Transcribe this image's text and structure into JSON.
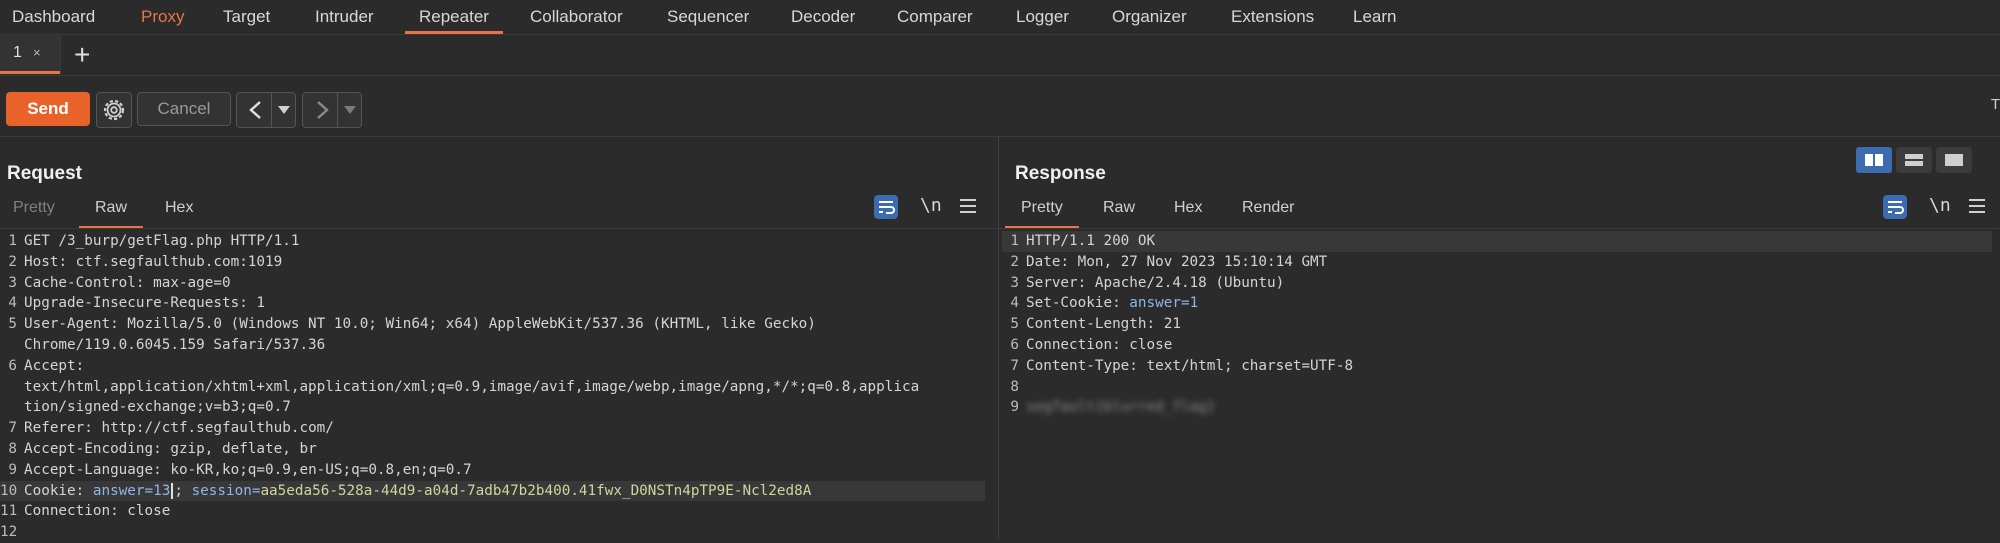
{
  "nav": {
    "tabs": [
      "Dashboard",
      "Proxy",
      "Target",
      "Intruder",
      "Repeater",
      "Collaborator",
      "Sequencer",
      "Decoder",
      "Comparer",
      "Logger",
      "Organizer",
      "Extensions",
      "Learn"
    ],
    "active": "Repeater"
  },
  "repeater_tabs": {
    "tab1": {
      "label": "1",
      "close": "×"
    },
    "add": "+"
  },
  "toolbar": {
    "send": "Send",
    "cancel": "Cancel",
    "right_text": "T"
  },
  "request": {
    "title": "Request",
    "tabs": [
      "Pretty",
      "Raw",
      "Hex"
    ],
    "active_tab": "Raw",
    "newline_toggle": "\\n",
    "lines": [
      {
        "n": "1",
        "t": "GET /3_burp/getFlag.php HTTP/1.1"
      },
      {
        "n": "2",
        "h": "Host",
        "v": "ctf.segfaulthub.com:1019"
      },
      {
        "n": "3",
        "h": "Cache-Control",
        "v": "max-age=0"
      },
      {
        "n": "4",
        "h": "Upgrade-Insecure-Requests",
        "v": "1"
      },
      {
        "n": "5",
        "h": "User-Agent",
        "v": "Mozilla/5.0 (Windows NT 10.0; Win64; x64) AppleWebKit/537.36 (KHTML, like Gecko)"
      },
      {
        "n": "",
        "t": "Chrome/119.0.6045.159 Safari/537.36"
      },
      {
        "n": "6",
        "t": "Accept:"
      },
      {
        "n": "",
        "t": "text/html,application/xhtml+xml,application/xml;q=0.9,image/avif,image/webp,image/apng,*/*;q=0.8,applica"
      },
      {
        "n": "",
        "t": "tion/signed-exchange;v=b3;q=0.7"
      },
      {
        "n": "7",
        "h": "Referer",
        "v": "http://ctf.segfaulthub.com/"
      },
      {
        "n": "8",
        "h": "Accept-Encoding",
        "v": "gzip, deflate, br"
      },
      {
        "n": "9",
        "h": "Accept-Language",
        "v": "ko-KR,ko;q=0.9,en-US;q=0.8,en;q=0.7"
      },
      {
        "n": "10",
        "cookie": true
      },
      {
        "n": "11",
        "h": "Connection",
        "v": "close"
      },
      {
        "n": "12",
        "t": ""
      }
    ],
    "cookie": {
      "header": "Cookie",
      "k1": "answer=",
      "v1": "13",
      "sep": "; ",
      "k2": "session=",
      "v2": "aa5eda56-528a-44d9-a04d-7adb47b2b400.41fwx_D0NSTn4pTP9E-Ncl2ed8A"
    }
  },
  "response": {
    "title": "Response",
    "tabs": [
      "Pretty",
      "Raw",
      "Hex",
      "Render"
    ],
    "active_tab": "Pretty",
    "newline_toggle": "\\n",
    "lines": [
      {
        "n": "1",
        "t": "HTTP/1.1 200 OK"
      },
      {
        "n": "2",
        "h": "Date",
        "v": "Mon, 27 Nov 2023 15:10:14 GMT"
      },
      {
        "n": "3",
        "h": "Server",
        "v": "Apache/2.4.18 (Ubuntu)"
      },
      {
        "n": "4",
        "h": "Set-Cookie",
        "ck": "answer=",
        "cv": "1"
      },
      {
        "n": "5",
        "h": "Content-Length",
        "v": "21"
      },
      {
        "n": "6",
        "h": "Connection",
        "v": "close"
      },
      {
        "n": "7",
        "h": "Content-Type",
        "v": "text/html; charset=UTF-8"
      },
      {
        "n": "8",
        "t": ""
      },
      {
        "n": "9",
        "t": "segfault{blurred_flag}",
        "blur": true
      }
    ]
  },
  "colors": {
    "accent": "#e8744a",
    "send": "#e8622a",
    "toggle_blue": "#3d6bb0",
    "cookie_key": "#8db6e8",
    "cookie_val": "#cdd79a"
  }
}
